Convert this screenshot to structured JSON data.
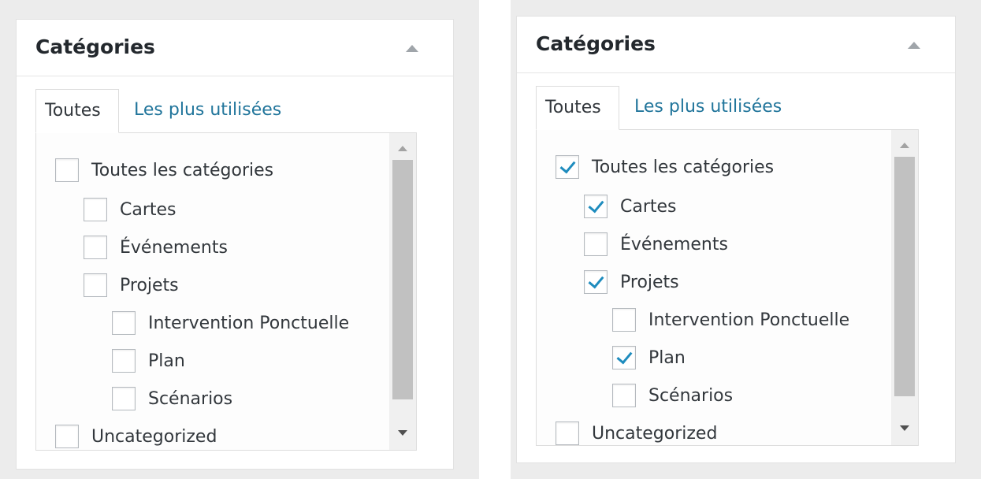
{
  "panels": [
    {
      "title": "Catégories",
      "tabs": [
        {
          "label": "Toutes",
          "active": true
        },
        {
          "label": "Les plus utilisées",
          "active": false
        }
      ],
      "categories": [
        {
          "label": "Toutes les catégories",
          "level": 0,
          "checked": false
        },
        {
          "label": "Cartes",
          "level": 1,
          "checked": false
        },
        {
          "label": "Événements",
          "level": 1,
          "checked": false
        },
        {
          "label": "Projets",
          "level": 1,
          "checked": false
        },
        {
          "label": "Intervention Ponctuelle",
          "level": 2,
          "checked": false
        },
        {
          "label": "Plan",
          "level": 2,
          "checked": false
        },
        {
          "label": "Scénarios",
          "level": 2,
          "checked": false
        },
        {
          "label": "Uncategorized",
          "level": 0,
          "checked": false
        }
      ]
    },
    {
      "title": "Catégories",
      "tabs": [
        {
          "label": "Toutes",
          "active": true
        },
        {
          "label": "Les plus utilisées",
          "active": false
        }
      ],
      "categories": [
        {
          "label": "Toutes les catégories",
          "level": 0,
          "checked": true
        },
        {
          "label": "Cartes",
          "level": 1,
          "checked": true
        },
        {
          "label": "Événements",
          "level": 1,
          "checked": false
        },
        {
          "label": "Projets",
          "level": 1,
          "checked": true
        },
        {
          "label": "Intervention Ponctuelle",
          "level": 2,
          "checked": false
        },
        {
          "label": "Plan",
          "level": 2,
          "checked": true
        },
        {
          "label": "Scénarios",
          "level": 2,
          "checked": false
        },
        {
          "label": "Uncategorized",
          "level": 0,
          "checked": false
        }
      ]
    }
  ],
  "colors": {
    "link": "#21759b",
    "check": "#1e8cbe",
    "text": "#32373c"
  },
  "icons": {
    "collapse": "triangle-up-icon",
    "check": "checkmark-icon",
    "scroll_up": "scroll-up-arrow-icon",
    "scroll_down": "scroll-down-arrow-icon"
  }
}
